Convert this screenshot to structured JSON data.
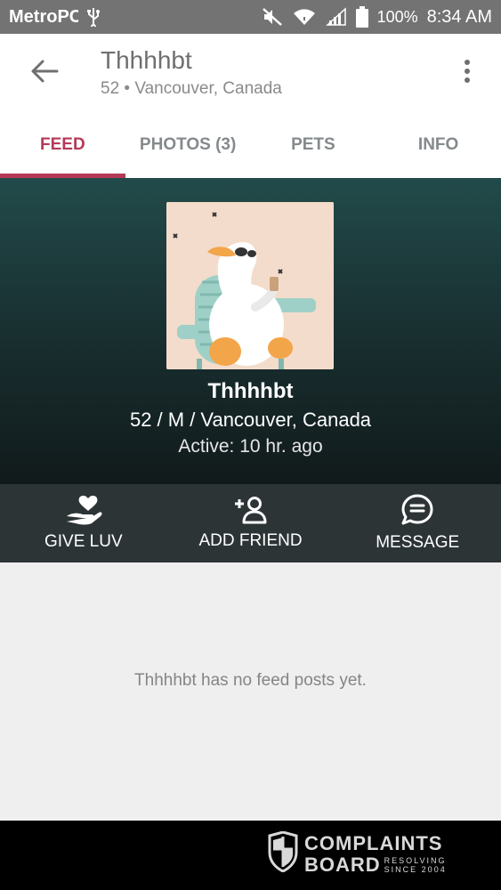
{
  "status_bar": {
    "carrier": "MetroPCS",
    "battery": "100%",
    "time": "8:34 AM",
    "icons": [
      "usb-icon",
      "mute-icon",
      "wifi-icon",
      "signal-icon",
      "battery-icon"
    ]
  },
  "app_bar": {
    "title": "Thhhhbt",
    "subtitle": "52 • Vancouver, Canada",
    "icons": [
      "back-arrow-icon",
      "more-vertical-icon"
    ]
  },
  "tabs": [
    {
      "label": "FEED",
      "active": true
    },
    {
      "label": "PHOTOS (3)",
      "active": false
    },
    {
      "label": "PETS",
      "active": false
    },
    {
      "label": "INFO",
      "active": false
    }
  ],
  "profile": {
    "name": "Thhhhbt",
    "details": "52 / M / Vancouver, Canada",
    "active": "Active: 10 hr. ago"
  },
  "actions": [
    {
      "label": "GIVE LUV",
      "icon": "heart-hand-icon"
    },
    {
      "label": "ADD FRIEND",
      "icon": "add-person-icon"
    },
    {
      "label": "MESSAGE",
      "icon": "chat-bubble-icon"
    }
  ],
  "feed": {
    "empty_message": "Thhhhbt has no feed posts yet."
  },
  "watermark": {
    "line1": "COMPLAINTS",
    "line2": "BOARD",
    "tag1": "RESOLVING",
    "tag2": "SINCE 2004"
  },
  "colors": {
    "accent": "#b53957",
    "status_bar": "#737373",
    "action_bar": "#2c3436",
    "hero_top": "#224a4a",
    "feed_bg": "#efefef"
  }
}
